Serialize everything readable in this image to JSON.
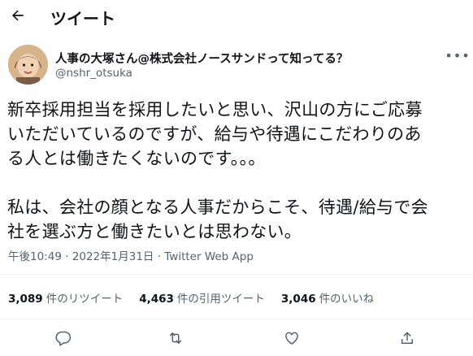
{
  "header": {
    "title": "ツイート"
  },
  "author": {
    "name": "人事の大塚さん@株式会社ノースサンドって知ってる？",
    "handle": "@nshr_otsuka"
  },
  "tweet": {
    "text": "新卒採用担当を採用したいと思い、沢山の方にご応募\nいただいているのですが、給与や待遇にこだわりのあ\nる人とは働きたくないのです。。。\n\n私は、会社の顔となる人事だからこそ、待遇/給与で会\n社を選ぶ方と働きたいとは思わない。",
    "meta": "午後10:49 · 2022年1月31日 · Twitter Web App"
  },
  "stats": {
    "retweets": {
      "count": "3,089",
      "label": "件のリツイート"
    },
    "quotes": {
      "count": "4,463",
      "label": "件の引用ツイート"
    },
    "likes": {
      "count": "3,046",
      "label": "件のいいね"
    }
  },
  "icons": {
    "back": "back-arrow-icon",
    "more": "more-icon",
    "reply": "reply-icon",
    "retweet": "retweet-icon",
    "like": "like-icon",
    "share": "share-icon"
  },
  "colors": {
    "text": "#0f1419",
    "secondary": "#536471",
    "divider": "#eff3f4"
  }
}
